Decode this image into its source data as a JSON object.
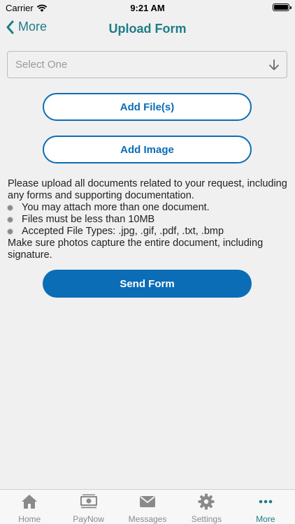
{
  "status_bar": {
    "carrier": "Carrier",
    "time": "9:21 AM"
  },
  "nav": {
    "back_label": "More",
    "title": "Upload Form"
  },
  "select": {
    "placeholder": "Select One"
  },
  "buttons": {
    "add_files": "Add File(s)",
    "add_image": "Add Image",
    "send_form": "Send Form"
  },
  "instructions": {
    "intro": "Please upload all documents related to your request, including any forms and supporting documentation.",
    "bullets": [
      "You may attach more than one document.",
      "Files must be less than 10MB",
      "Accepted File Types: .jpg, .gif, .pdf, .txt, .bmp"
    ],
    "outro": "Make sure photos capture the entire document, including signature."
  },
  "tabs": [
    {
      "label": "Home",
      "icon": "home-icon"
    },
    {
      "label": "PayNow",
      "icon": "cash-icon"
    },
    {
      "label": "Messages",
      "icon": "mail-icon"
    },
    {
      "label": "Settings",
      "icon": "gear-icon"
    },
    {
      "label": "More",
      "icon": "more-icon",
      "active": true
    }
  ],
  "colors": {
    "accent": "#1e7d86",
    "button": "#0b6db5",
    "inactive": "#8a8a8a"
  }
}
